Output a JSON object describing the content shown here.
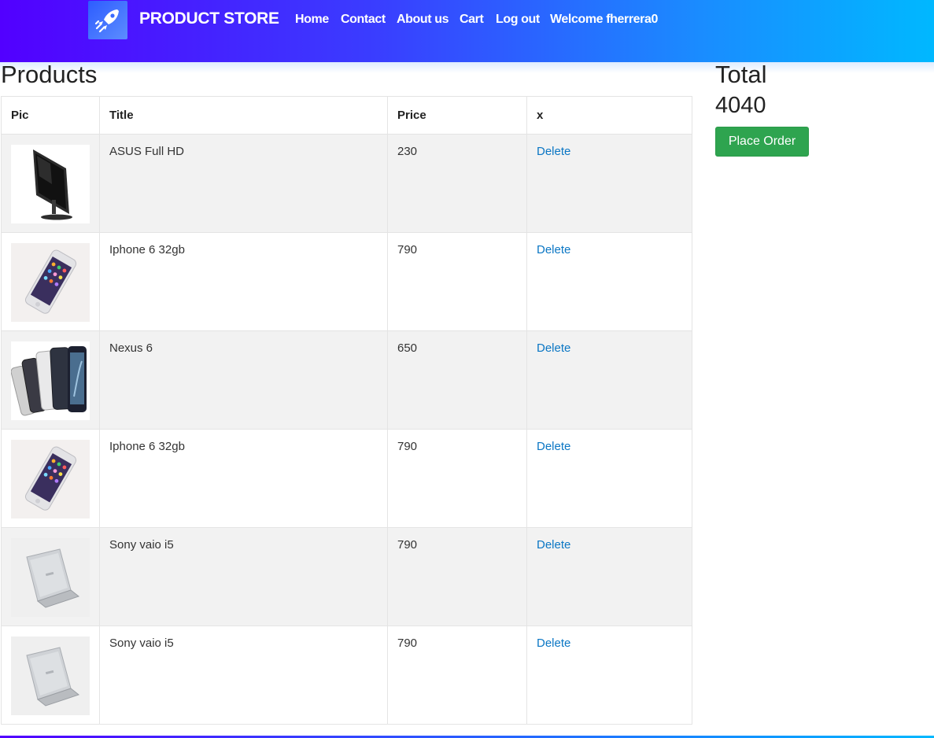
{
  "navbar": {
    "brand": "PRODUCT STORE",
    "links": [
      "Home",
      "Contact",
      "About us",
      "Cart",
      "Log out",
      "Welcome fherrera0"
    ]
  },
  "products": {
    "heading": "Products",
    "columns": [
      "Pic",
      "Title",
      "Price",
      "x"
    ],
    "rows": [
      {
        "image": "monitor",
        "title": "ASUS Full HD",
        "price": "230",
        "action": "Delete"
      },
      {
        "image": "phone-white",
        "title": "Iphone 6 32gb",
        "price": "790",
        "action": "Delete"
      },
      {
        "image": "phones-group",
        "title": "Nexus 6",
        "price": "650",
        "action": "Delete"
      },
      {
        "image": "phone-white",
        "title": "Iphone 6 32gb",
        "price": "790",
        "action": "Delete"
      },
      {
        "image": "laptop-silver",
        "title": "Sony vaio i5",
        "price": "790",
        "action": "Delete"
      },
      {
        "image": "laptop-silver",
        "title": "Sony vaio i5",
        "price": "790",
        "action": "Delete"
      }
    ]
  },
  "summary": {
    "heading": "Total",
    "total": "4040",
    "place_order_label": "Place Order"
  },
  "colors": {
    "place_order": "#2ea44f",
    "delete_link": "#0a76c4",
    "navbar_start": "#5200ff",
    "navbar_end": "#00b8ff"
  }
}
